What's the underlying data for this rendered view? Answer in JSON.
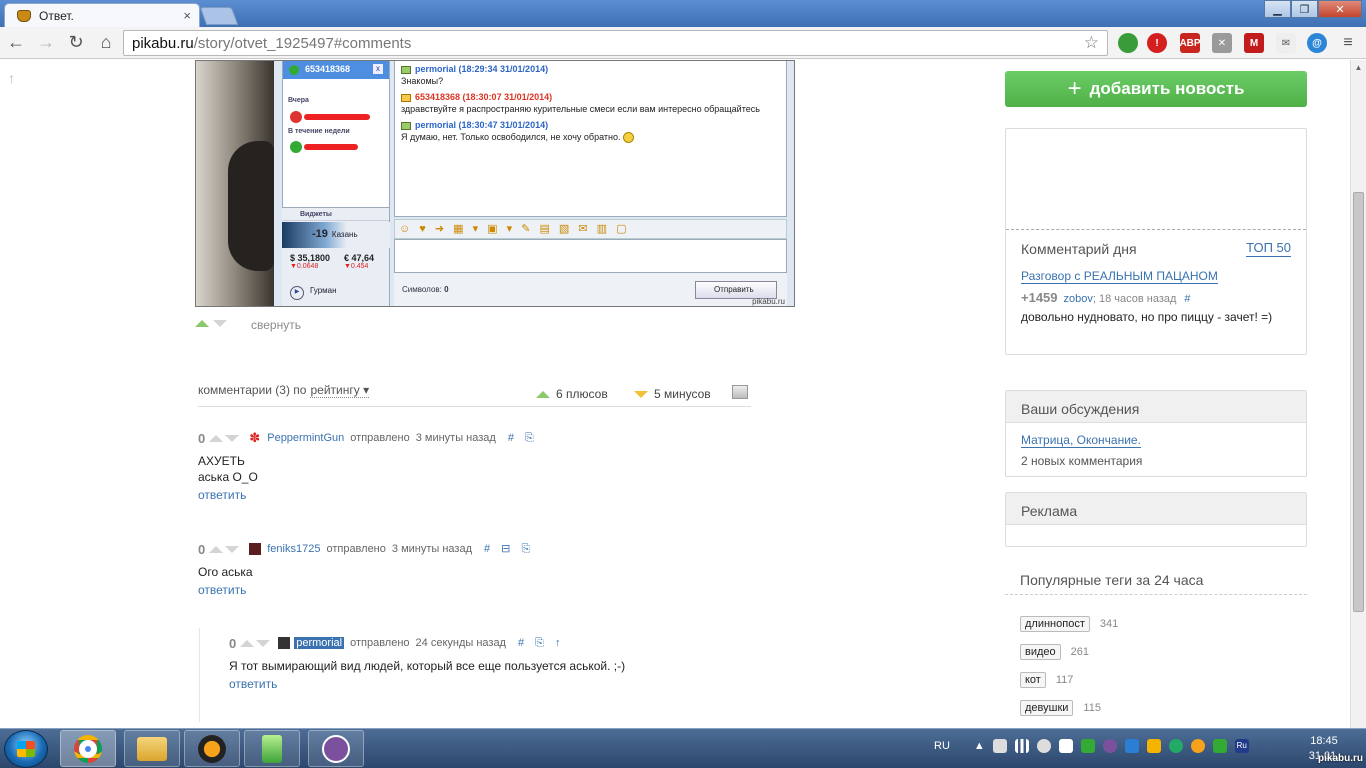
{
  "browser": {
    "tab_title": "Ответ.",
    "tab_close": "×",
    "url_host": "pikabu.ru",
    "url_path": "/story/otvet_1925497#comments",
    "win_min": "▁",
    "win_max": "❐",
    "win_close": "✕"
  },
  "screenshot": {
    "contact_selected": "653418368",
    "group_yesterday": "Вчера",
    "group_week": "В течение недели",
    "widgets_label": "Виджеты",
    "weather_temp": "-19",
    "weather_city": "Казань",
    "usd": "35,1800",
    "usd_delta": "▼0.0648",
    "eur": "47,64",
    "eur_delta": "▼0.454",
    "gurman": "Гурман",
    "msg1_head": "permorial (18:29:34 31/01/2014)",
    "msg1_text": "Знакомы?",
    "msg2_head": "653418368 (18:30:07 31/01/2014)",
    "msg2_text": "здравствуйте я распространяю курительные смеси если вам интересно обращайтесь",
    "msg3_head": "permorial (18:30:47 31/01/2014)",
    "msg3_text": "Я думаю, нет. Только освободился, не хочу обратно.",
    "chars_label": "Символов:",
    "chars_value": "0",
    "send_label": "Отправить",
    "watermark": "pikabu.ru"
  },
  "post": {
    "collapse_label": "свернуть"
  },
  "comments_header": {
    "prefix": "комментарии (3) по",
    "sort": "рейтингу",
    "plus_label": "6 плюсов",
    "minus_label": "5 минусов"
  },
  "comments": [
    {
      "score": "0",
      "user": "PeppermintGun",
      "sent": "отправлено",
      "when": "3 минуты назад",
      "links": "# ⎘",
      "lines": [
        "АХУЕТЬ",
        "аська О_О"
      ],
      "reply": "ответить"
    },
    {
      "score": "0",
      "user": "feniks1725",
      "sent": "отправлено",
      "when": "3 минуты назад",
      "links": "# ⊟ ⎘",
      "lines": [
        "Ого аська"
      ],
      "reply": "ответить"
    },
    {
      "score": "0",
      "user": "permorial",
      "sent": "отправлено",
      "when": "24 секунды назад",
      "links": "# ⎘ ↑",
      "lines": [
        "Я тот вымирающий вид людей, который все еще пользуется аськой. ;-)"
      ],
      "reply": "ответить"
    }
  ],
  "sidebar": {
    "add_news": "добавить новость",
    "cod_title": "Комментарий дня",
    "cod_top": "ТОП 50",
    "cod_link": "Разговор с РЕАЛЬНЫМ ПАЦАНОМ",
    "cod_score": "+1459",
    "cod_author": "zobov",
    "cod_when": "; 18 часов назад",
    "cod_hash": "#",
    "cod_text": "довольно нудновато, но про пиццу - зачет! =)",
    "disc_title": "Ваши обсуждения",
    "disc_link": "Матрица, Окончание.",
    "disc_count": "2 новых комментария",
    "ads_title": "Реклама",
    "tags_title": "Популярные теги за 24 часа",
    "tags": [
      {
        "tag": "длиннопост",
        "count": "341"
      },
      {
        "tag": "видео",
        "count": "261"
      },
      {
        "tag": "кот",
        "count": "117"
      },
      {
        "tag": "девушки",
        "count": "115"
      }
    ]
  },
  "taskbar": {
    "lang": "RU",
    "time": "18:45",
    "date": "31.01.",
    "watermark": "pikabu.ru"
  },
  "colors": {
    "accent_green": "#5cbf57",
    "link_blue": "#3a72b0",
    "taskbar": "#2c476c"
  }
}
